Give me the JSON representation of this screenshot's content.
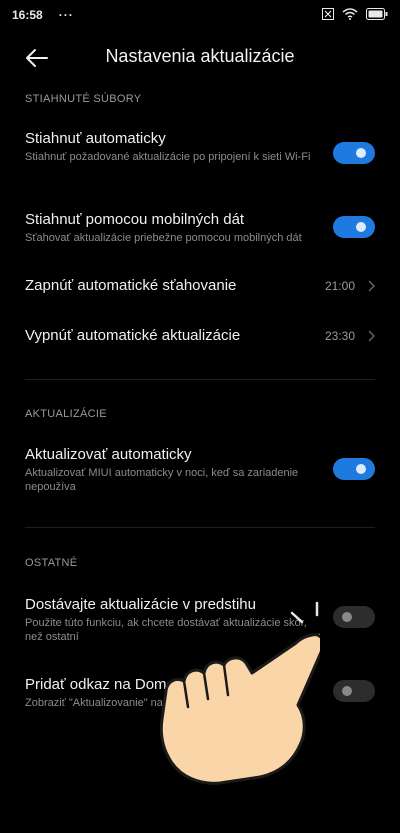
{
  "status_bar": {
    "time": "16:58",
    "dots": "···",
    "icons": [
      "close-box-icon",
      "wifi-icon",
      "battery-icon"
    ]
  },
  "header": {
    "back_icon": "arrow-left-icon",
    "title": "Nastavenia aktualizácie"
  },
  "sections": {
    "downloads": {
      "label": "STIAHNUTÉ SÚBORY",
      "auto_download": {
        "title": "Stiahnuť automaticky",
        "subtitle": "Stiahnuť požadované aktualizácie po pripojení k sieti Wi-Fi",
        "enabled": true
      },
      "mobile_data": {
        "title": "Stiahnuť pomocou mobilných dát",
        "subtitle": "Sťahovať aktualizácie priebežne pomocou mobilných dát",
        "enabled": true
      },
      "auto_start": {
        "title": "Zapnúť automatické sťahovanie",
        "value": "21:00"
      },
      "auto_stop": {
        "title": "Vypnúť automatické aktualizácie",
        "value": "23:30"
      }
    },
    "updates": {
      "label": "AKTUALIZÁCIE",
      "auto_update": {
        "title": "Aktualizovať automaticky",
        "subtitle": "Aktualizovať MIUI automaticky v noci, keď sa zariadenie nepoužíva",
        "enabled": true
      }
    },
    "other": {
      "label": "OSTATNÉ",
      "early_updates": {
        "title": "Dostávajte aktualizácie v predstihu",
        "subtitle": "Použite túto funkciu, ak chcete dostávať aktualizácie skôr, než ostatní",
        "enabled": false
      },
      "home_shortcut": {
        "title": "Pridať odkaz na Domov",
        "subtitle": "Zobraziť \"Aktualizovanie\" na D",
        "enabled": false
      }
    }
  },
  "colors": {
    "accent": "#1f7ae0",
    "background": "#000000",
    "hand_fill": "#f9d5a7"
  },
  "overlay": {
    "icon": "tap-hand-icon"
  }
}
